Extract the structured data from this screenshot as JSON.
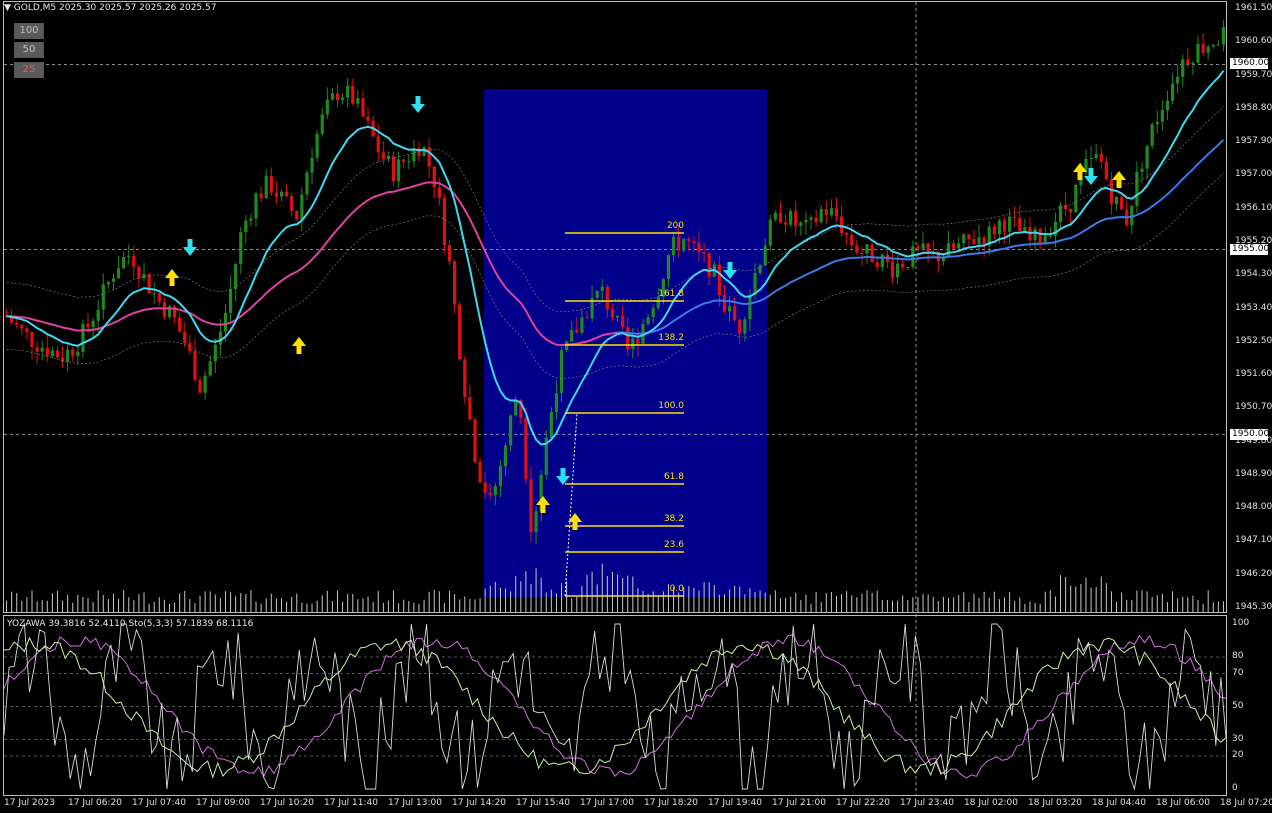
{
  "header": {
    "symbol_ohlc": "GOLD,M5  2025.30 2025.57 2025.26 2025.57"
  },
  "buttons": [
    "100",
    "50",
    "25"
  ],
  "price_axis": [
    "1961.50",
    "1960.60",
    "1959.70",
    "1958.80",
    "1957.90",
    "1957.00",
    "1956.10",
    "1955.20",
    "1954.30",
    "1953.40",
    "1952.50",
    "1951.60",
    "1950.70",
    "1949.80",
    "1948.90",
    "1948.00",
    "1947.10",
    "1946.20",
    "1945.30"
  ],
  "price_tags": [
    "1960.00",
    "1955.00",
    "1950.00"
  ],
  "fib_levels": [
    "200",
    "161.8",
    "138.2",
    "100.0",
    "61.8",
    "38.2",
    "23.6",
    "0.0"
  ],
  "indicator": {
    "label": "YOZAWA 39.3816 52.4110  Sto(5,3,3) 57.1839 68.1116",
    "axis": [
      "100",
      "80",
      "70",
      "50",
      "30",
      "20",
      "0"
    ]
  },
  "time_axis": [
    "17 Jul 2023",
    "17 Jul 06:20",
    "17 Jul 07:40",
    "17 Jul 09:00",
    "17 Jul 10:20",
    "17 Jul 11:40",
    "17 Jul 13:00",
    "17 Jul 14:20",
    "17 Jul 15:40",
    "17 Jul 17:00",
    "17 Jul 18:20",
    "17 Jul 19:40",
    "17 Jul 21:00",
    "17 Jul 22:20",
    "17 Jul 23:40",
    "18 Jul 02:00",
    "18 Jul 03:20",
    "18 Jul 04:40",
    "18 Jul 06:00",
    "18 Jul 07:20"
  ],
  "colors": {
    "bull": "#1f8a1f",
    "bear": "#e01010",
    "fib_zone": "#00008b",
    "fib_line": "#ffe000",
    "ma_cyan": "#40d8f0",
    "ma_blue": "#3a7ae8",
    "ma_pink": "#e040a0",
    "arrow_up": "#ffe000",
    "arrow_down": "#30e0f0"
  },
  "chart_data": {
    "type": "candlestick",
    "symbol": "GOLD",
    "timeframe": "M5",
    "close_path": [
      1953.2,
      1952.8,
      1952.5,
      1952.3,
      1952.1,
      1952.4,
      1953.0,
      1953.8,
      1954.6,
      1954.9,
      1954.2,
      1953.6,
      1953.2,
      1952.4,
      1951.3,
      1952.2,
      1953.5,
      1955.5,
      1956.4,
      1956.8,
      1956.3,
      1955.9,
      1957.6,
      1958.7,
      1959.3,
      1959.1,
      1958.4,
      1957.6,
      1957.1,
      1957.5,
      1957.9,
      1956.8,
      1954.7,
      1951.6,
      1949.2,
      1948.1,
      1949.6,
      1951.3,
      1947.3,
      1949.8,
      1951.9,
      1952.7,
      1953.4,
      1953.9,
      1953.1,
      1952.2,
      1953.0,
      1953.8,
      1955.0,
      1955.3,
      1954.8,
      1954.5,
      1953.4,
      1952.9,
      1954.2,
      1955.4,
      1956.0,
      1955.7,
      1955.5,
      1956.1,
      1955.9,
      1955.2,
      1954.9,
      1954.8,
      1954.5,
      1954.7,
      1954.9,
      1954.8,
      1954.9,
      1955.1,
      1955.3,
      1955.4,
      1955.8,
      1955.6,
      1955.2,
      1955.4,
      1955.9,
      1956.3,
      1957.2,
      1957.5,
      1956.4,
      1955.8,
      1957.3,
      1958.4,
      1959.3,
      1960.1,
      1960.4,
      1960.6,
      1960.8
    ]
  }
}
